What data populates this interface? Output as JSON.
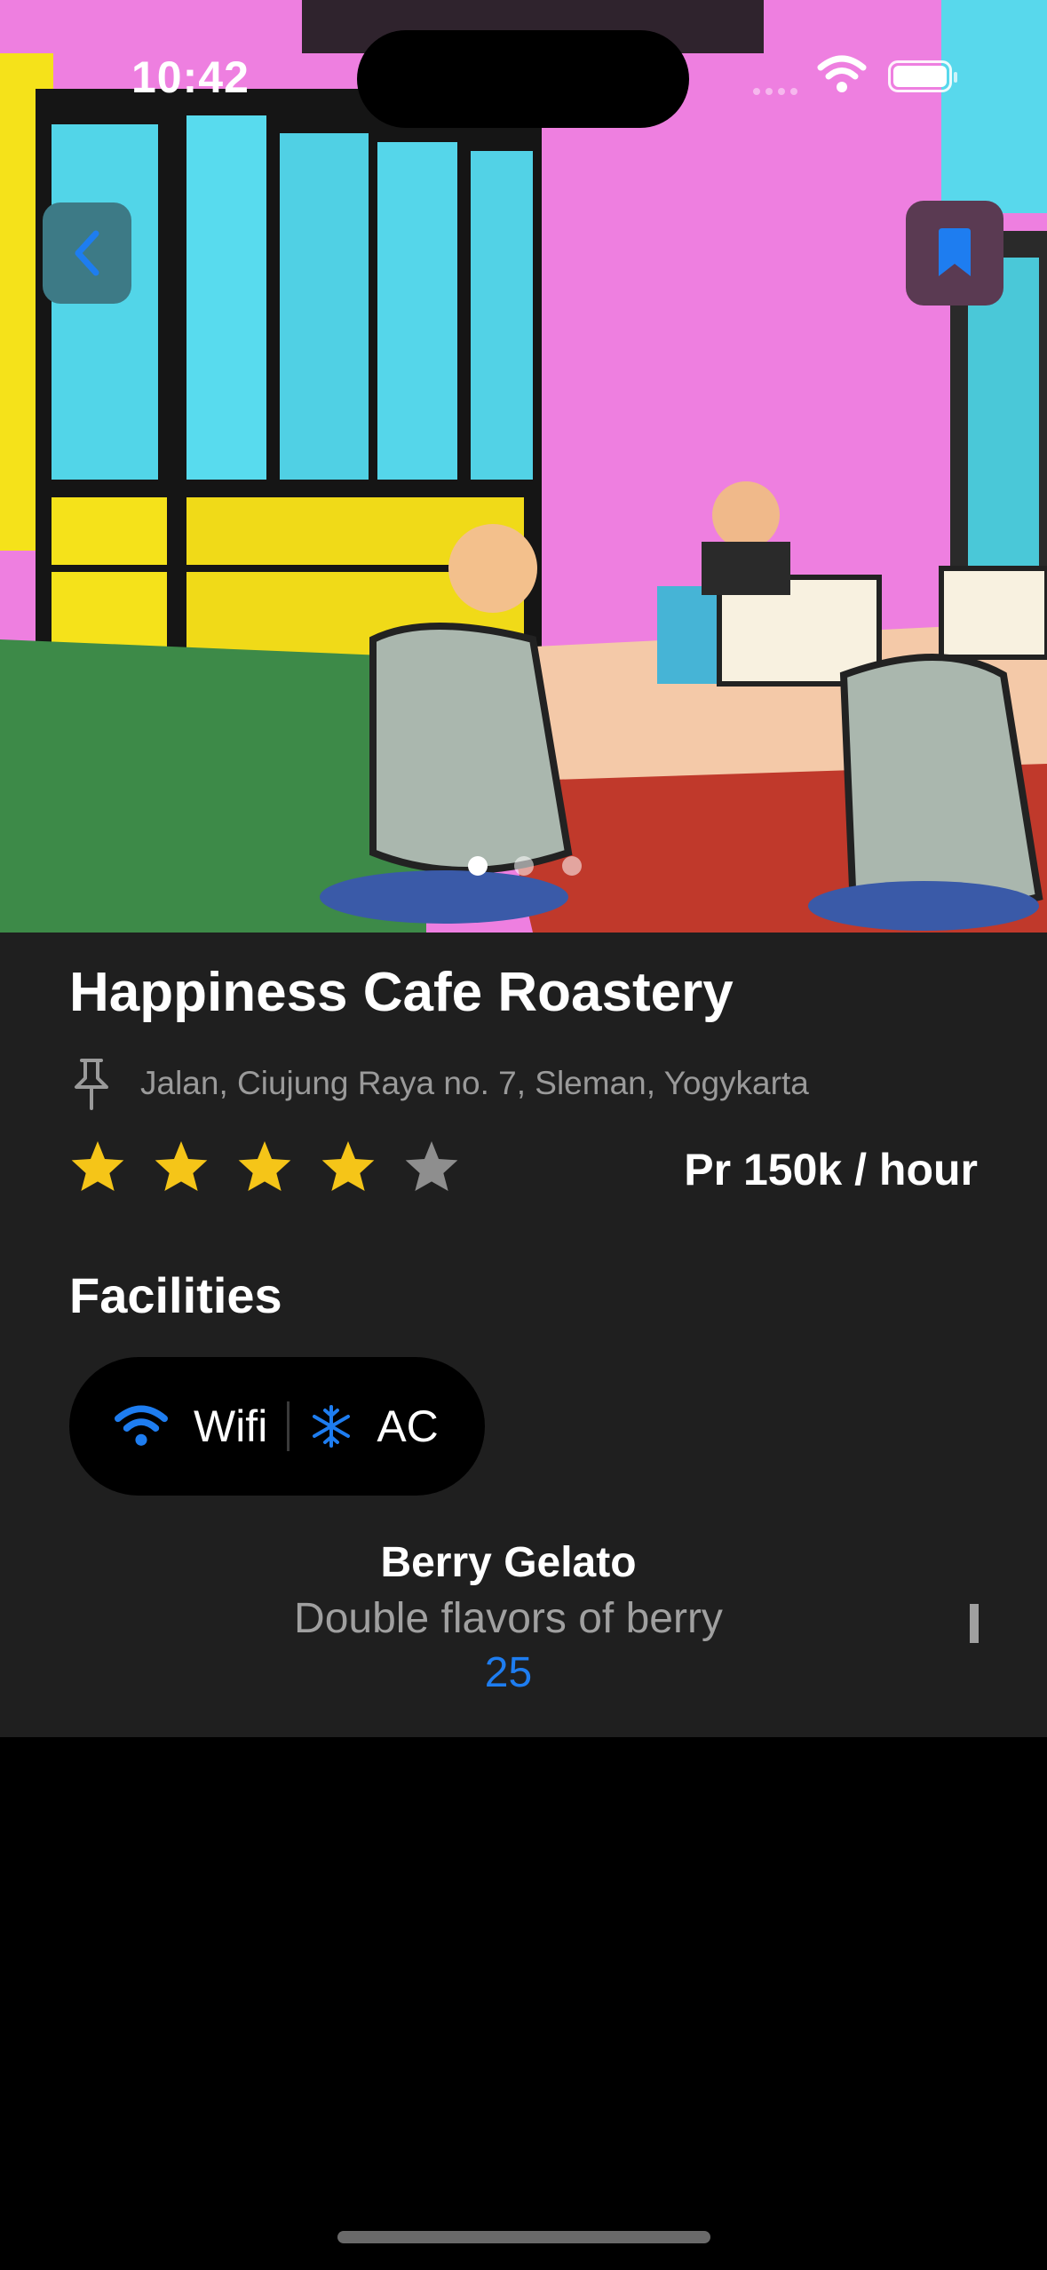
{
  "status_bar": {
    "time": "10:42"
  },
  "hero": {
    "image": "cafe-illustration",
    "page_count": 3,
    "current_page": 1
  },
  "venue": {
    "name": "Happiness Cafe Roastery",
    "address": "Jalan, Ciujung Raya no. 7, Sleman, Yogykarta",
    "rating": 4,
    "rating_max": 5,
    "price": "Pr 150k / hour"
  },
  "facilities": {
    "title": "Facilities",
    "items": [
      {
        "label": "Wifi",
        "icon": "wifi-icon"
      },
      {
        "label": "AC",
        "icon": "snowflake-icon"
      }
    ]
  },
  "menu": [
    {
      "name": "Berry Gelato",
      "description": "Double flavors of berry",
      "price": "25"
    }
  ],
  "colors": {
    "accent": "#1e7df0",
    "star": "#f5c518",
    "star_off": "#8e8e8e",
    "sheet": "#1f1f1f"
  }
}
